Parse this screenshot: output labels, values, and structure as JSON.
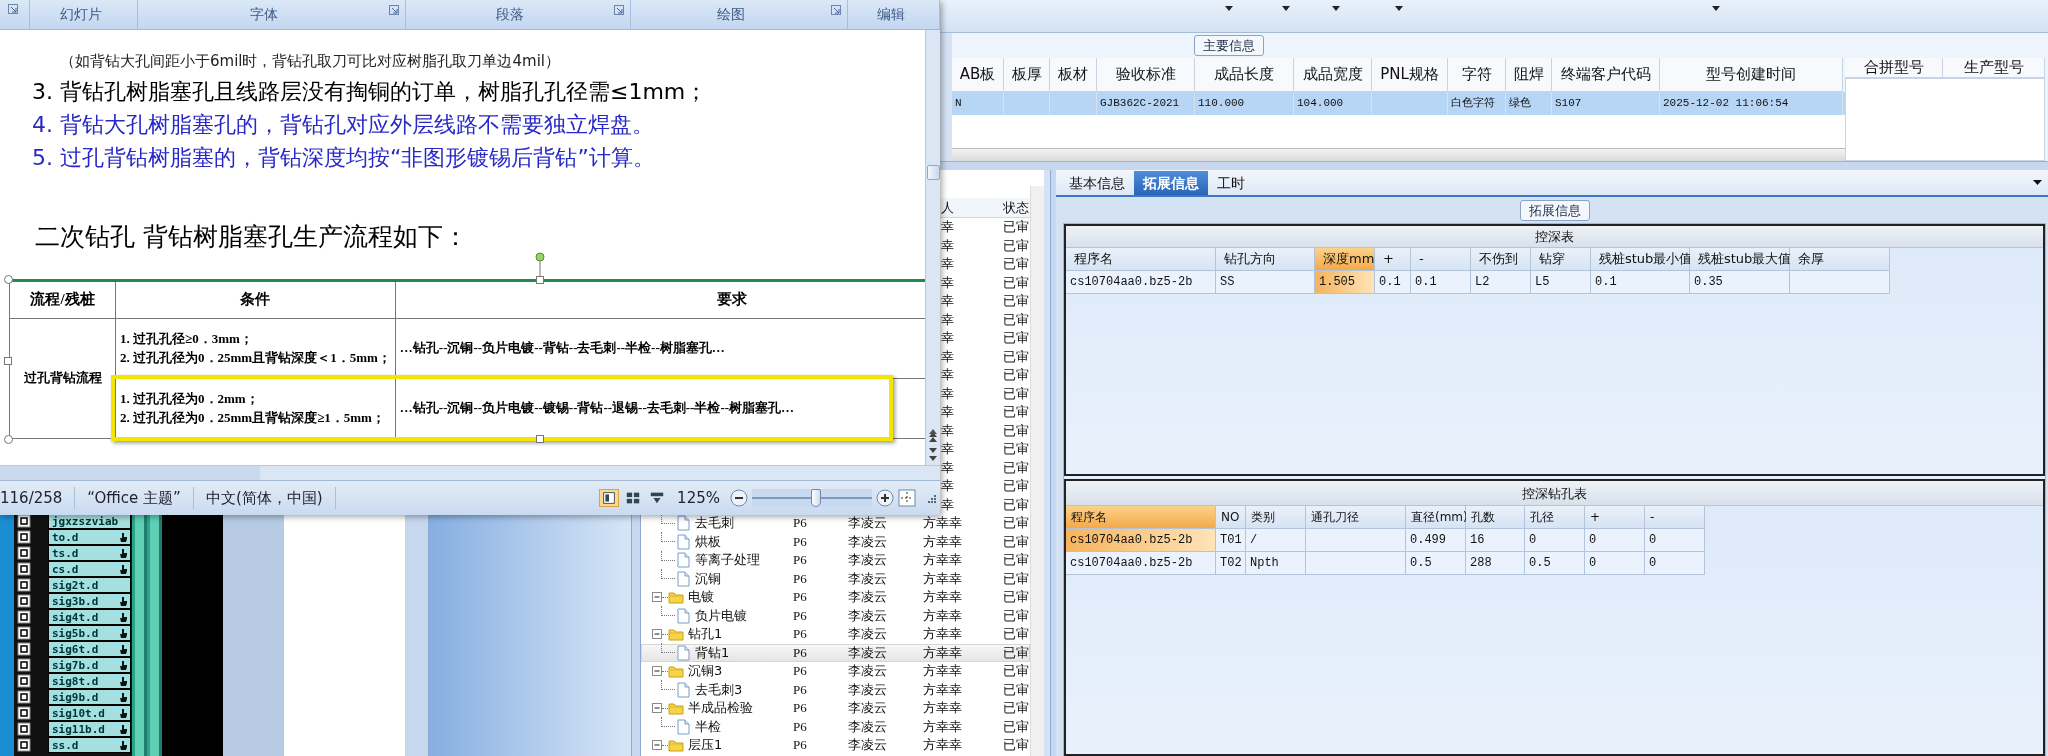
{
  "word_window": {
    "ribbon_groups": [
      {
        "label": "幻灯片",
        "launcher": false
      },
      {
        "label": "字体",
        "launcher": true
      },
      {
        "label": "段落",
        "launcher": true
      },
      {
        "label": "绘图",
        "launcher": true
      },
      {
        "label": "编辑",
        "launcher": false
      }
    ],
    "paragraphs": [
      {
        "kind": "note",
        "text": "（如背钻大孔间距小于6mil时，背钻孔取刀可比对应树脂孔取刀单边4mil）"
      },
      {
        "kind": "item",
        "number": "3.",
        "text": "背钻孔树脂塞孔且线路层没有掏铜的订单，树脂孔孔径需≤1mm；",
        "color": "#000000"
      },
      {
        "kind": "item",
        "number": "4.",
        "text": "背钻大孔树脂塞孔的，背钻孔对应外层线路不需要独立焊盘。",
        "color": "#2828c8"
      },
      {
        "kind": "item",
        "number": "5.",
        "text": "过孔背钻树脂塞的，背钻深度均按“非图形镀锡后背钻”计算。",
        "color": "#2828c8"
      },
      {
        "kind": "heading",
        "text": "二次钻孔 背钻树脂塞孔生产流程如下："
      }
    ],
    "table": {
      "columns": [
        "流程/残桩",
        "条件",
        "要求"
      ],
      "group_label": "过孔背钻流程",
      "rows": [
        {
          "conditions": [
            "1. 过孔孔径≥0．3mm；",
            "2. 过孔孔径为0．25mm且背钻深度＜1．5mm；"
          ],
          "flow": "…钻孔--沉铜--负片电镀--背钻--去毛刺--半检--树脂塞孔…",
          "highlighted": false
        },
        {
          "conditions": [
            "1. 过孔孔径为0．2mm；",
            "2. 过孔孔径为0．25mm且背钻深度≥1．5mm；"
          ],
          "flow": "…钻孔--沉铜--负片电镀--镀锡--背钻--退锡--去毛刺--半检--树脂塞孔…",
          "highlighted": true
        }
      ]
    },
    "status_bar": {
      "page": "116/258",
      "theme": "“Office 主题”",
      "language": "中文(简体，中国)",
      "views": [
        {
          "kind": "print",
          "selected": true
        },
        {
          "kind": "reading",
          "selected": false
        },
        {
          "kind": "web",
          "selected": false
        }
      ],
      "zoom": "125%",
      "zoom_slider": {
        "level": 0.53
      }
    }
  },
  "main_info": {
    "title": "主要信息",
    "columns": [
      "AB板",
      "板厚",
      "板材",
      "验收标准",
      "成品长度",
      "成品宽度",
      "PNL规格",
      "字符",
      "阻焊",
      "终端客户代码",
      "型号创建时间"
    ],
    "rows": [
      {
        "selected": true,
        "cells": [
          "N",
          null,
          null,
          "GJB362C-2021",
          "110.000",
          "104.000",
          null,
          "白色字符",
          "绿色",
          "S107",
          "2025-12-02 11:06:54"
        ]
      }
    ]
  },
  "merge_table": {
    "columns": [
      "合拼型号",
      "生产型号"
    ]
  },
  "layers": [
    {
      "name": "jgxzszviab",
      "flagged": false,
      "checked": true
    },
    {
      "name": "to.d",
      "flagged": true,
      "checked": true
    },
    {
      "name": "ts.d",
      "flagged": true,
      "checked": true
    },
    {
      "name": "cs.d",
      "flagged": true,
      "checked": true
    },
    {
      "name": "sig2t.d",
      "flagged": false,
      "checked": true
    },
    {
      "name": "sig3b.d",
      "flagged": true,
      "checked": true
    },
    {
      "name": "sig4t.d",
      "flagged": true,
      "checked": true
    },
    {
      "name": "sig5b.d",
      "flagged": true,
      "checked": true
    },
    {
      "name": "sig6t.d",
      "flagged": true,
      "checked": true
    },
    {
      "name": "sig7b.d",
      "flagged": true,
      "checked": true
    },
    {
      "name": "sig8t.d",
      "flagged": true,
      "checked": true
    },
    {
      "name": "sig9b.d",
      "flagged": true,
      "checked": true
    },
    {
      "name": "sig10t.d",
      "flagged": true,
      "checked": true
    },
    {
      "name": "sig11b.d",
      "flagged": true,
      "checked": true
    },
    {
      "name": "ss.d",
      "flagged": true,
      "checked": true
    }
  ],
  "tree": {
    "columns": [
      "人",
      "状态"
    ],
    "rows": [
      {
        "kind": "clipped",
        "approver": "幸",
        "status": "已审",
        "selected": false
      },
      {
        "kind": "clipped",
        "approver": "幸",
        "status": "已审",
        "selected": false
      },
      {
        "kind": "clipped",
        "approver": "幸",
        "status": "已审",
        "selected": false
      },
      {
        "kind": "clipped",
        "approver": "幸",
        "status": "已审",
        "selected": false
      },
      {
        "kind": "clipped",
        "approver": "幸",
        "status": "已审",
        "selected": false
      },
      {
        "kind": "clipped",
        "approver": "幸",
        "status": "已审",
        "selected": false
      },
      {
        "kind": "clipped",
        "approver": "幸",
        "status": "已审",
        "selected": false
      },
      {
        "kind": "clipped",
        "approver": "幸",
        "status": "已审",
        "selected": false
      },
      {
        "kind": "clipped",
        "approver": "幸",
        "status": "已审",
        "selected": false
      },
      {
        "kind": "clipped",
        "approver": "幸",
        "status": "已审",
        "selected": false
      },
      {
        "kind": "clipped",
        "approver": "幸",
        "status": "已审",
        "selected": false
      },
      {
        "kind": "clipped",
        "approver": "幸",
        "status": "已审",
        "selected": false
      },
      {
        "kind": "clipped",
        "approver": "幸",
        "status": "已审",
        "selected": false
      },
      {
        "kind": "clipped",
        "approver": "幸",
        "status": "已审",
        "selected": false
      },
      {
        "kind": "clipped",
        "approver": "幸",
        "status": "已审",
        "selected": false
      },
      {
        "kind": "clipped",
        "approver": "幸",
        "status": "已审",
        "selected": false
      },
      {
        "kind": "leaf",
        "name": "去毛刺",
        "grade": "P6",
        "creator": "李凌云",
        "approver": "方幸幸",
        "status": "已审",
        "selected": false
      },
      {
        "kind": "leaf",
        "name": "烘板",
        "grade": "P6",
        "creator": "李凌云",
        "approver": "方幸幸",
        "status": "已审",
        "selected": false
      },
      {
        "kind": "leaf",
        "name": "等离子处理",
        "grade": "P6",
        "creator": "李凌云",
        "approver": "方幸幸",
        "status": "已审",
        "selected": false
      },
      {
        "kind": "leaf",
        "name": "沉铜",
        "grade": "P6",
        "creator": "李凌云",
        "approver": "方幸幸",
        "status": "已审",
        "selected": false
      },
      {
        "kind": "folder",
        "name": "电镀",
        "grade": "P6",
        "creator": "李凌云",
        "approver": "方幸幸",
        "status": "已审",
        "selected": false,
        "expanded": true,
        "children": [
          {
            "kind": "leaf",
            "name": "负片电镀",
            "grade": "P6",
            "creator": "李凌云",
            "approver": "方幸幸",
            "status": "已审",
            "selected": false
          }
        ]
      },
      {
        "kind": "folder",
        "name": "钻孔1",
        "grade": "P6",
        "creator": "李凌云",
        "approver": "方幸幸",
        "status": "已审",
        "selected": false,
        "expanded": true,
        "children": [
          {
            "kind": "leaf",
            "name": "背钻1",
            "grade": "P6",
            "creator": "李凌云",
            "approver": "方幸幸",
            "status": "已审",
            "selected": true
          }
        ]
      },
      {
        "kind": "folder",
        "name": "沉铜3",
        "grade": "P6",
        "creator": "李凌云",
        "approver": "方幸幸",
        "status": "已审",
        "selected": false,
        "expanded": true,
        "children": [
          {
            "kind": "leaf",
            "name": "去毛刺3",
            "grade": "P6",
            "creator": "李凌云",
            "approver": "方幸幸",
            "status": "已审",
            "selected": false
          }
        ]
      },
      {
        "kind": "folder",
        "name": "半成品检验",
        "grade": "P6",
        "creator": "李凌云",
        "approver": "方幸幸",
        "status": "已审",
        "selected": false,
        "expanded": true,
        "children": [
          {
            "kind": "leaf",
            "name": "半检",
            "grade": "P6",
            "creator": "李凌云",
            "approver": "方幸幸",
            "status": "已审",
            "selected": false
          }
        ]
      },
      {
        "kind": "folder",
        "name": "层压1",
        "grade": "P6",
        "creator": "李凌云",
        "approver": "方幸幸",
        "status": "已审",
        "selected": false,
        "expanded": true
      }
    ]
  },
  "detail": {
    "tabs": [
      {
        "label": "基本信息",
        "selected": false
      },
      {
        "label": "拓展信息",
        "selected": true
      },
      {
        "label": "工时",
        "selected": false
      }
    ],
    "group_title": "拓展信息",
    "depth_table": {
      "title": "控深表",
      "columns": [
        {
          "label": "程序名",
          "selected": false
        },
        {
          "label": "钻孔方向",
          "selected": false
        },
        {
          "label": "深度mm",
          "selected": true
        },
        {
          "label": "+",
          "selected": false
        },
        {
          "label": "-",
          "selected": false
        },
        {
          "label": "不伤到",
          "selected": false
        },
        {
          "label": "钻穿",
          "selected": false
        },
        {
          "label": "残桩stub最小值",
          "selected": false
        },
        {
          "label": "残桩stub最大值",
          "selected": false
        },
        {
          "label": "余厚",
          "selected": false
        }
      ],
      "rows": [
        {
          "selected": true,
          "cells": [
            "cs10704aa0.bz5-2b",
            "SS",
            "1.505",
            "0.1",
            "0.1",
            "L2",
            "L5",
            "0.1",
            "0.35",
            null
          ]
        }
      ]
    },
    "hole_table": {
      "title": "控深钻孔表",
      "columns": [
        {
          "label": "程序名",
          "selected": true
        },
        {
          "label": "NO",
          "selected": false
        },
        {
          "label": "类别",
          "selected": false
        },
        {
          "label": "通孔刀径",
          "selected": false
        },
        {
          "label": "直径(mm)",
          "selected": false
        },
        {
          "label": "孔数",
          "selected": false
        },
        {
          "label": "孔径",
          "selected": false
        },
        {
          "label": "+",
          "selected": false
        },
        {
          "label": "-",
          "selected": false
        }
      ],
      "rows": [
        {
          "selected": true,
          "cells": [
            "cs10704aa0.bz5-2b",
            "T01",
            "/",
            null,
            "0.499",
            "16",
            "0",
            "0",
            "0"
          ]
        },
        {
          "selected": false,
          "cells": [
            "cs10704aa0.bz5-2b",
            "T02",
            "Npth",
            null,
            "0.5",
            "288",
            "0.5",
            "0",
            "0"
          ]
        }
      ]
    }
  }
}
